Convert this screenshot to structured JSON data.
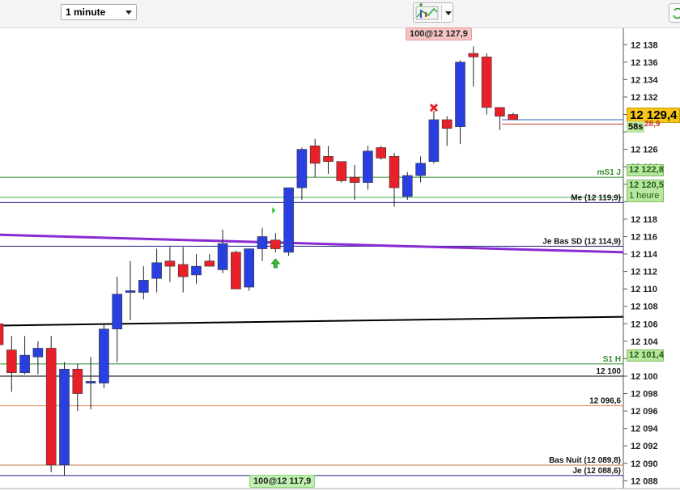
{
  "toolbar": {
    "timeframe": "1 minute"
  },
  "chart_data": {
    "type": "candlestick",
    "y_axis": {
      "ylim": [
        12087.2,
        12139.6
      ],
      "ticks": [
        12138,
        12136,
        12134,
        12132,
        12130,
        12128,
        12126,
        12124,
        12122,
        12120,
        12118,
        12116,
        12114,
        12112,
        12110,
        12108,
        12106,
        12104,
        12102,
        12100,
        12098,
        12096,
        12094,
        12092,
        12090,
        12088
      ],
      "tick_labels": [
        "12 138",
        "12 136",
        "12 134",
        "12 132",
        "",
        "",
        "12 126",
        "12 124",
        "",
        "",
        "12 118",
        "12 116",
        "12 114",
        "12 112",
        "12 110",
        "12 108",
        "12 106",
        "12 104",
        "",
        "12 100",
        "12 098",
        "12 096",
        "12 094",
        "12 092",
        "12 090",
        "12 088"
      ]
    },
    "grid": false,
    "candles": [
      {
        "o": 12106,
        "h": 12106.4,
        "l": 12102,
        "c": 12103.6
      },
      {
        "o": 12103,
        "h": 12104.6,
        "l": 12098.2,
        "c": 12100.4
      },
      {
        "o": 12100.4,
        "h": 12104.6,
        "l": 12100.2,
        "c": 12102.4
      },
      {
        "o": 12102.2,
        "h": 12104,
        "l": 12100.2,
        "c": 12103.2
      },
      {
        "o": 12103.2,
        "h": 12104.6,
        "l": 12089,
        "c": 12089.8
      },
      {
        "o": 12089.8,
        "h": 12101.6,
        "l": 12088.6,
        "c": 12100.8
      },
      {
        "o": 12100.8,
        "h": 12101.4,
        "l": 12096,
        "c": 12098
      },
      {
        "o": 12099.2,
        "h": 12102.2,
        "l": 12096.2,
        "c": 12099.4
      },
      {
        "o": 12099.2,
        "h": 12106,
        "l": 12098.6,
        "c": 12105.4
      },
      {
        "o": 12105.4,
        "h": 12111.4,
        "l": 12101.6,
        "c": 12109.4
      },
      {
        "o": 12109.6,
        "h": 12113.2,
        "l": 12106.4,
        "c": 12109.8
      },
      {
        "o": 12109.6,
        "h": 12112.6,
        "l": 12108.8,
        "c": 12111
      },
      {
        "o": 12111.2,
        "h": 12114.6,
        "l": 12109.6,
        "c": 12113
      },
      {
        "o": 12113.2,
        "h": 12114.8,
        "l": 12110.8,
        "c": 12112.6
      },
      {
        "o": 12112.8,
        "h": 12114.8,
        "l": 12109.6,
        "c": 12111.4
      },
      {
        "o": 12111.6,
        "h": 12114,
        "l": 12110.6,
        "c": 12112.6
      },
      {
        "o": 12113.2,
        "h": 12114,
        "l": 12112.6,
        "c": 12112.6
      },
      {
        "o": 12112.2,
        "h": 12116.8,
        "l": 12111.8,
        "c": 12115.2
      },
      {
        "o": 12114.2,
        "h": 12114.4,
        "l": 12111.2,
        "c": 12110
      },
      {
        "o": 12110.2,
        "h": 12114.6,
        "l": 12109.8,
        "c": 12114.6
      },
      {
        "o": 12114.6,
        "h": 12117,
        "l": 12113.2,
        "c": 12116
      },
      {
        "o": 12115.6,
        "h": 12116.4,
        "l": 12114.2,
        "c": 12114.6
      },
      {
        "o": 12114.2,
        "h": 12120,
        "l": 12113.8,
        "c": 12121.6
      },
      {
        "o": 12121.6,
        "h": 12126.2,
        "l": 12120.2,
        "c": 12126
      },
      {
        "o": 12126.4,
        "h": 12127.2,
        "l": 12122.8,
        "c": 12124.4
      },
      {
        "o": 12125.2,
        "h": 12126.4,
        "l": 12123.2,
        "c": 12124.6
      },
      {
        "o": 12124.6,
        "h": 12124.6,
        "l": 12122.2,
        "c": 12122.4
      },
      {
        "o": 12122.8,
        "h": 12124.2,
        "l": 12120.2,
        "c": 12122.2
      },
      {
        "o": 12122.2,
        "h": 12126.4,
        "l": 12121.4,
        "c": 12125.8
      },
      {
        "o": 12126.2,
        "h": 12126.4,
        "l": 12124.8,
        "c": 12125
      },
      {
        "o": 12125.2,
        "h": 12125.6,
        "l": 12119.4,
        "c": 12121.6
      },
      {
        "o": 12120.6,
        "h": 12123.4,
        "l": 12120.2,
        "c": 12123
      },
      {
        "o": 12123,
        "h": 12125.2,
        "l": 12122.2,
        "c": 12124.4
      },
      {
        "o": 12124.6,
        "h": 12130.4,
        "l": 12124.4,
        "c": 12129.4
      },
      {
        "o": 12129.4,
        "h": 12129.8,
        "l": 12126.4,
        "c": 12128.4
      },
      {
        "o": 12128.6,
        "h": 12136.2,
        "l": 12126.6,
        "c": 12136
      },
      {
        "o": 12137,
        "h": 12137.8,
        "l": 12133.2,
        "c": 12136.6
      },
      {
        "o": 12136.6,
        "h": 12137,
        "l": 12130,
        "c": 12130.8
      },
      {
        "o": 12130.8,
        "h": 12130.8,
        "l": 12128.2,
        "c": 12129.8
      },
      {
        "o": 12130,
        "h": 12130.2,
        "l": 12129.4,
        "c": 12129.4
      }
    ],
    "horizontal_lines": [
      {
        "label": "mS1 J",
        "value": 12122.8,
        "color": "#2e8b2e",
        "axis_tag": "12 122,8"
      },
      {
        "label": "",
        "value": 12120.5,
        "color": "#4caf50",
        "axis_tag": "12 120,5",
        "axis_tag2": "1 heure"
      },
      {
        "label": "Me (12 119,9)",
        "value": 12119.9,
        "color": "#1f1f8a"
      },
      {
        "label": "Je Bas SD (12 114,9)",
        "value": 12114.9,
        "color": "#1f1f8a"
      },
      {
        "label": "S1 H",
        "value": 12101.4,
        "color": "#2e8b2e",
        "axis_tag": "12 101,4"
      },
      {
        "label": "12 100",
        "value": 12100,
        "color": "#000000"
      },
      {
        "label": "12 096,6",
        "value": 12096.6,
        "color": "#e08850"
      },
      {
        "label": "Bas Nuit (12 089,8)",
        "value": 12089.8,
        "color": "#c07b3b"
      },
      {
        "label": "Je (12 088,6)",
        "value": 12088.6,
        "color": "#1f1f8a"
      },
      {
        "label": "",
        "value": 12129.4,
        "color": "#3060c0"
      },
      {
        "label": "",
        "value": 12128.9,
        "color": "#c0392b"
      }
    ],
    "trend_lines": [
      {
        "color": "#8a2bd2",
        "from_value": 12116.2,
        "to_value": 12114.2
      },
      {
        "color": "#000000",
        "from_value": 12105.8,
        "to_value": 12106.8
      }
    ],
    "annotations": {
      "top_tag": "100@12 127,9",
      "bottom_tag": "100@12 117,9",
      "current_price": "12 129,4",
      "countdown": "58s",
      "last_tick": "28,9",
      "one_hour_label": "1 heure"
    },
    "colors": {
      "up": "#2a3fe0",
      "down": "#e8202a",
      "wick": "#222222"
    }
  }
}
